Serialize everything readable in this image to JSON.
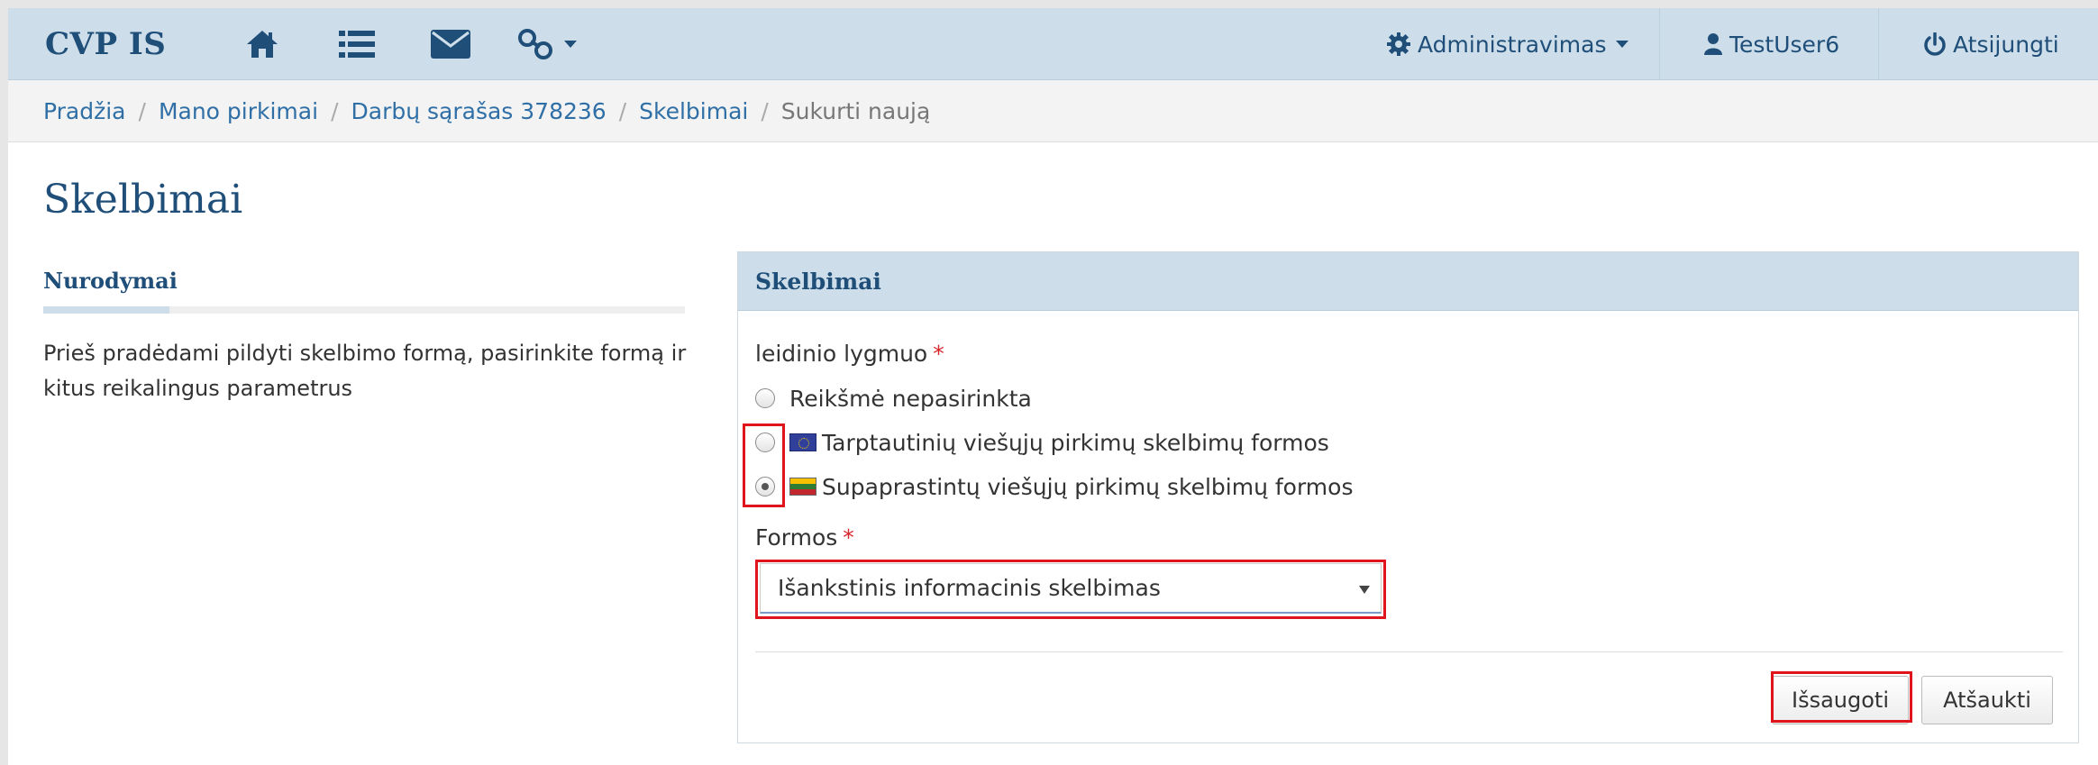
{
  "navbar": {
    "brand": "CVP IS",
    "admin_label": "Administravimas",
    "user_label": "TestUser6",
    "logout_label": "Atsijungti"
  },
  "breadcrumb": {
    "items": [
      "Pradžia",
      "Mano pirkimai",
      "Darbų sąrašas 378236",
      "Skelbimai"
    ],
    "current": "Sukurti naują",
    "separator": "/"
  },
  "page": {
    "title": "Skelbimai"
  },
  "instructions": {
    "title": "Nurodymai",
    "text": "Prieš pradėdami pildyti skelbimo formą, pasirinkite formą ir kitus reikalingus parametrus"
  },
  "panel": {
    "title": "Skelbimai",
    "level_label": "leidinio lygmuo",
    "required_mark": "*",
    "radios": [
      {
        "label": "Reikšmė nepasirinkta",
        "checked": false,
        "flag": ""
      },
      {
        "label": "Tarptautinių viešųjų pirkimų skelbimų formos",
        "checked": false,
        "flag": "eu-flag"
      },
      {
        "label": "Supaprastintų viešųjų pirkimų skelbimų formos",
        "checked": true,
        "flag": "lt-flag"
      }
    ],
    "forms_label": "Formos",
    "forms_selected": "Išankstinis informacinis skelbimas",
    "save_label": "Išsaugoti",
    "cancel_label": "Atšaukti"
  },
  "colors": {
    "brand": "#1f4e79",
    "navbar_bg": "#cddeea",
    "link": "#2f6fa6",
    "required": "#d9262c",
    "highlight": "#e0141c"
  }
}
